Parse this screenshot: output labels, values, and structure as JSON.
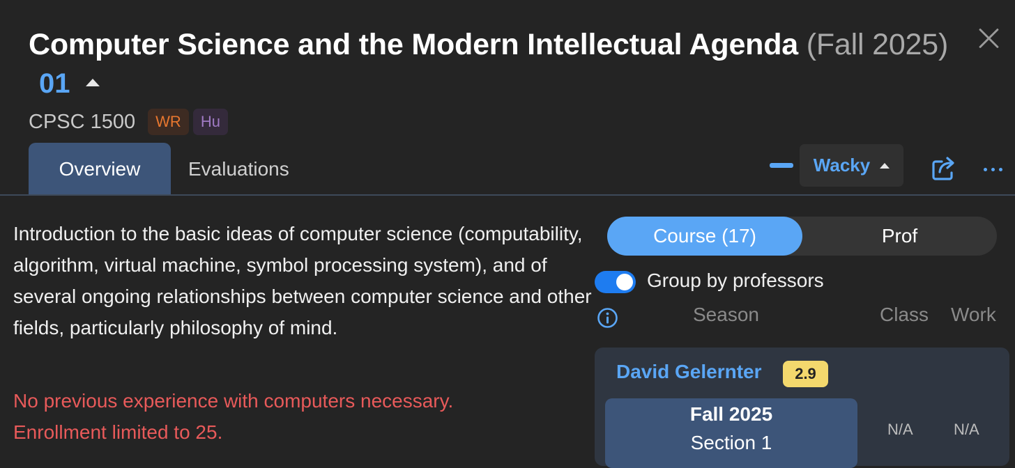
{
  "header": {
    "title": "Computer Science and the Modern Intellectual Agenda",
    "term": "(Fall 2025)",
    "section": "01",
    "course_code": "CPSC 1500",
    "badges": [
      "WR",
      "Hu"
    ]
  },
  "tabs": [
    {
      "label": "Overview",
      "active": true
    },
    {
      "label": "Evaluations",
      "active": false
    }
  ],
  "toolbar": {
    "mode_label": "Wacky",
    "icons": [
      "minus-icon",
      "chevron-up-icon",
      "share-icon",
      "more-icon"
    ],
    "accent_color": "#5aa6f5"
  },
  "overview": {
    "description": "Introduction to the basic ideas of computer science (computability, algorithm, virtual machine, symbol processing system), and of several ongoing relationships between computer science and other fields, particularly philosophy of mind.",
    "requirements": [
      "No previous experience with computers necessary.",
      "Enrollment limited to 25."
    ]
  },
  "evaluations_panel": {
    "segments": [
      "Course (17)",
      "Prof"
    ],
    "active_segment": "Course (17)",
    "group_toggle_label": "Group by professors",
    "group_toggle_on": true,
    "columns": [
      "Season",
      "Class",
      "Work"
    ],
    "professors": [
      {
        "name": "David Gelernter",
        "rating": "2.9",
        "rating_color": "#f3d86d",
        "offerings": [
          {
            "season": "Fall 2025",
            "section": "Section 1",
            "class": "N/A",
            "work": "N/A"
          }
        ]
      }
    ]
  }
}
